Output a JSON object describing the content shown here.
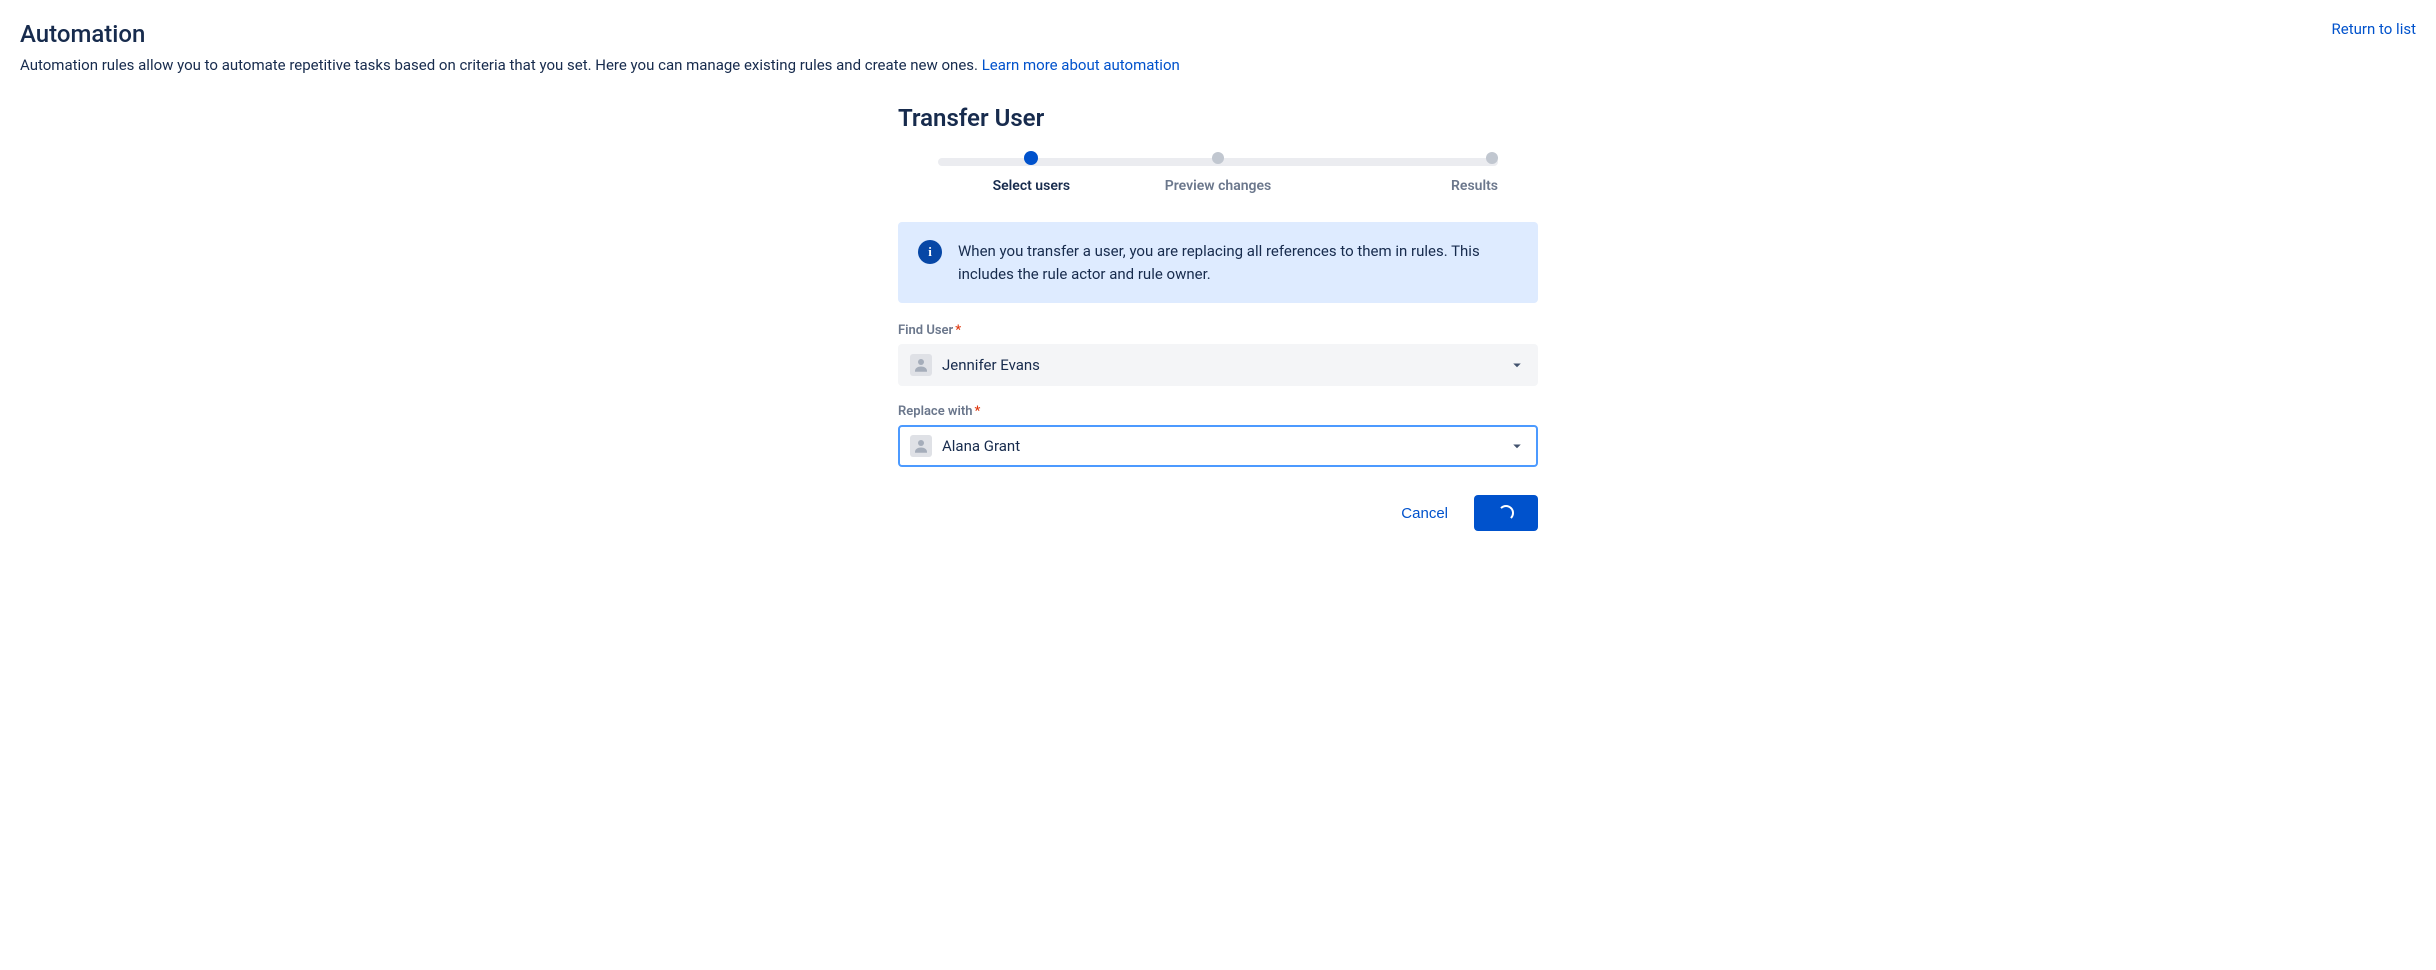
{
  "header": {
    "title": "Automation",
    "return_link": "Return to list"
  },
  "description": {
    "text": "Automation rules allow you to automate repetitive tasks based on criteria that you set. Here you can manage existing rules and create new ones. ",
    "link": "Learn more about automation"
  },
  "transfer": {
    "title": "Transfer User",
    "steps": {
      "s1": "Select users",
      "s2": "Preview changes",
      "s3": "Results"
    },
    "info": "When you transfer a user, you are replacing all references to them in rules. This includes the rule actor and rule owner.",
    "find_label": "Find User",
    "find_value": "Jennifer Evans",
    "replace_label": "Replace with",
    "replace_value": "Alana Grant",
    "cancel": "Cancel"
  }
}
